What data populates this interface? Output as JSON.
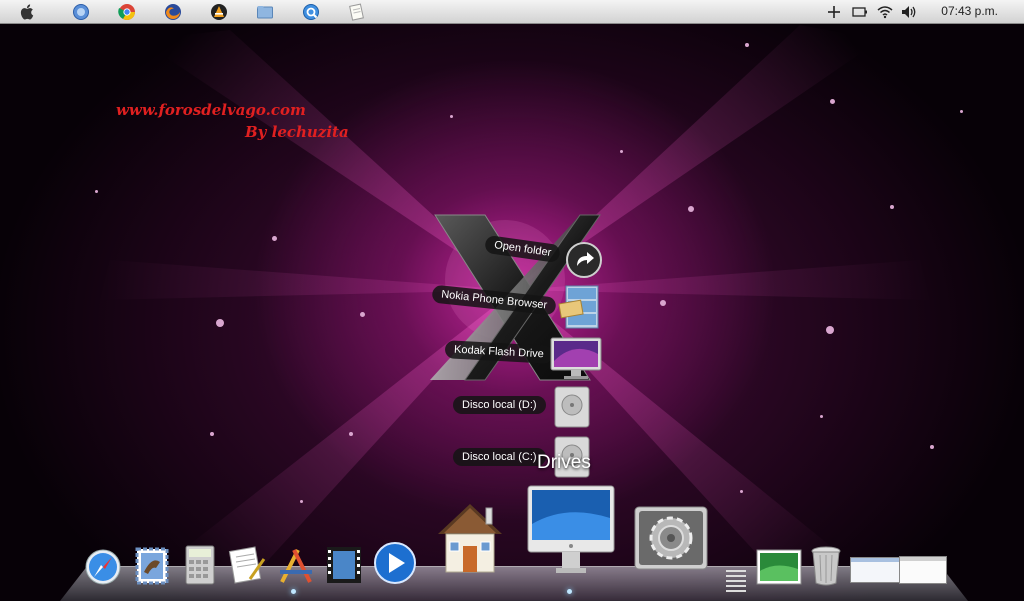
{
  "menubar": {
    "apps": [
      "apple-icon",
      "finder-icon",
      "chrome-icon",
      "firefox-icon",
      "vlc-icon",
      "folder-icon",
      "quicktime-icon",
      "notes-icon"
    ],
    "clock": "07:43 p.m.",
    "status_icons": [
      "plus-icon",
      "battery-icon",
      "wifi-icon",
      "volume-icon"
    ]
  },
  "watermark": {
    "line1": "www.forosdelvago.com",
    "line2": "By lechuzita"
  },
  "stack": {
    "title": "Drives",
    "items": [
      {
        "label": "Open folder"
      },
      {
        "label": "Nokia Phone Browser"
      },
      {
        "label": "Kodak Flash Drive"
      },
      {
        "label": "Disco local (D:)"
      },
      {
        "label": "Disco local (C:)"
      }
    ]
  },
  "dock": {
    "items": [
      "safari-icon",
      "mail-icon",
      "calculator-icon",
      "textedit-icon",
      "app-store-icon",
      "movie-icon",
      "media-player-icon",
      "home-folder-icon",
      "imac-icon",
      "system-preferences-icon",
      "separator",
      "photo-icon",
      "trash-icon",
      "window-thumbnail-1",
      "window-thumbnail-2"
    ]
  },
  "colors": {
    "accent": "#c21a9a",
    "watermark": "#e02020"
  }
}
